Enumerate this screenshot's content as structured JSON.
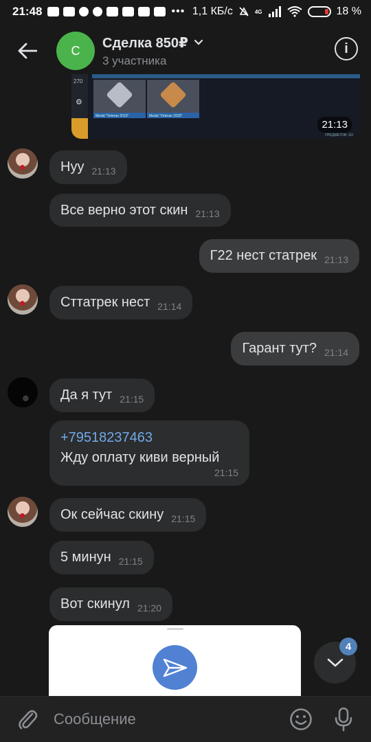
{
  "status_bar": {
    "time": "21:48",
    "dots": "•••",
    "network_speed": "1,1 КБ/с",
    "net_type": "4G",
    "battery": "18 %"
  },
  "header": {
    "avatar_letter": "С",
    "title": "Сделка 850₽",
    "subtitle": "3 участника"
  },
  "image_message": {
    "counter": "270",
    "medal1_caption": "Medal \"Veteran 2019\"",
    "medal2_caption": "Medal \"Veteran 2020\"",
    "footer": "ПРЕДМЕТОВ: 3/2",
    "time": "21:13"
  },
  "messages": [
    {
      "text": "Нуу",
      "time": "21:13",
      "dir": "in"
    },
    {
      "text": "Все верно этот скин",
      "time": "21:13",
      "dir": "in"
    },
    {
      "text": "Г22 нест статрек",
      "time": "21:13",
      "dir": "out"
    },
    {
      "text": "Сттатрек нест",
      "time": "21:14",
      "dir": "in"
    },
    {
      "text": "Гарант тут?",
      "time": "21:14",
      "dir": "out"
    },
    {
      "text": "Да я тут",
      "time": "21:15",
      "dir": "in"
    },
    {
      "phone": "+79518237463",
      "text": "Жду оплату киви верный",
      "time": "21:15",
      "dir": "in"
    },
    {
      "text": "Ок сейчас скину",
      "time": "21:15",
      "dir": "in"
    },
    {
      "text": "5 минун",
      "time": "21:15",
      "dir": "in"
    },
    {
      "text": "Вот скинул",
      "time": "21:20",
      "dir": "in"
    }
  ],
  "scroll_fab": {
    "badge": "4"
  },
  "composer": {
    "placeholder": "Сообщение"
  },
  "colors": {
    "accent": "#5181b8",
    "link": "#71aaeb",
    "chat_avatar": "#4bb34b"
  }
}
